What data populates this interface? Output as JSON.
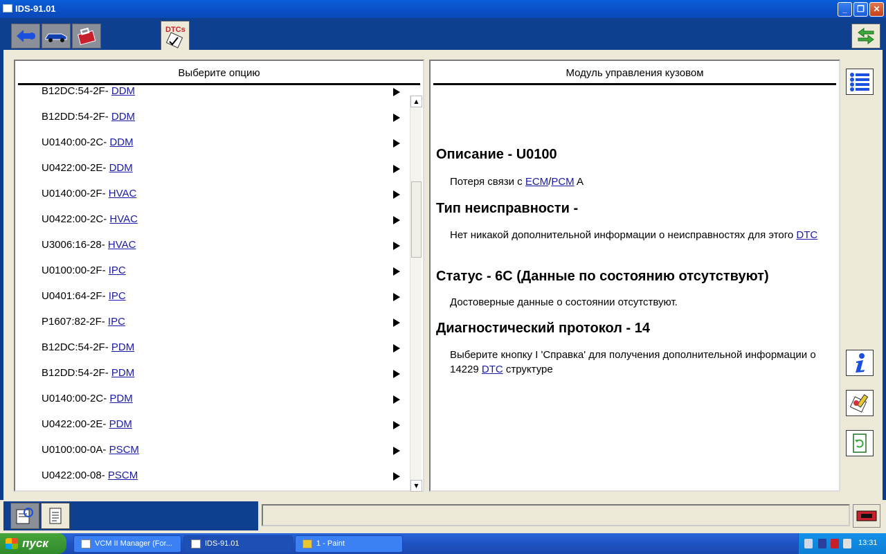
{
  "window": {
    "title": "IDS-91.01"
  },
  "toolbar": {
    "dtc_tab_label": "DTCs"
  },
  "left_panel": {
    "header": "Выберите опцию",
    "rows": [
      {
        "code": "B12DC:54-2F",
        "module": "DDM"
      },
      {
        "code": "B12DD:54-2F",
        "module": "DDM"
      },
      {
        "code": "U0140:00-2C",
        "module": "DDM"
      },
      {
        "code": "U0422:00-2E",
        "module": "DDM"
      },
      {
        "code": "U0140:00-2F",
        "module": "HVAC"
      },
      {
        "code": "U0422:00-2C",
        "module": "HVAC"
      },
      {
        "code": "U3006:16-28",
        "module": "HVAC"
      },
      {
        "code": "U0100:00-2F",
        "module": "IPC"
      },
      {
        "code": "U0401:64-2F",
        "module": "IPC"
      },
      {
        "code": "P1607:82-2F",
        "module": "IPC"
      },
      {
        "code": "B12DC:54-2F",
        "module": "PDM"
      },
      {
        "code": "B12DD:54-2F",
        "module": "PDM"
      },
      {
        "code": "U0140:00-2C",
        "module": "PDM"
      },
      {
        "code": "U0422:00-2E",
        "module": "PDM"
      },
      {
        "code": "U0100:00-0A",
        "module": "PSCM"
      },
      {
        "code": "U0422:00-08",
        "module": "PSCM"
      }
    ]
  },
  "right_panel": {
    "header": "Модуль управления кузовом",
    "description_heading": "Описание - U0100",
    "description_prefix": "Потеря связи с ",
    "description_link1": "ECM",
    "description_slash": "/",
    "description_link2": "PCM",
    "description_suffix": " A",
    "fault_type_heading": "Тип неисправности -",
    "fault_type_text": "Нет никакой дополнительной информации о неисправностях для этого ",
    "fault_type_link": "DTC",
    "status_heading": "Статус - 6C (Данные по состоянию отсутствуют)",
    "status_text": "Достоверные данные о состоянии отсутствуют.",
    "protocol_heading": "Диагностический протокол - 14",
    "protocol_text_prefix": "Выберите кнопку I 'Справка' для получения дополнительной информации о 14229 ",
    "protocol_link": "DTC",
    "protocol_text_suffix": " структуре"
  },
  "taskbar": {
    "start_label": "пуск",
    "tasks": [
      {
        "label": "VCM II Manager (For..."
      },
      {
        "label": "IDS-91.01"
      },
      {
        "label": "1 - Paint"
      }
    ],
    "clock": "13:31"
  },
  "colors": {
    "link": "#1a1aa8",
    "toolbar_bg": "#0f3f8f",
    "panel_bg": "#ece9d8"
  }
}
